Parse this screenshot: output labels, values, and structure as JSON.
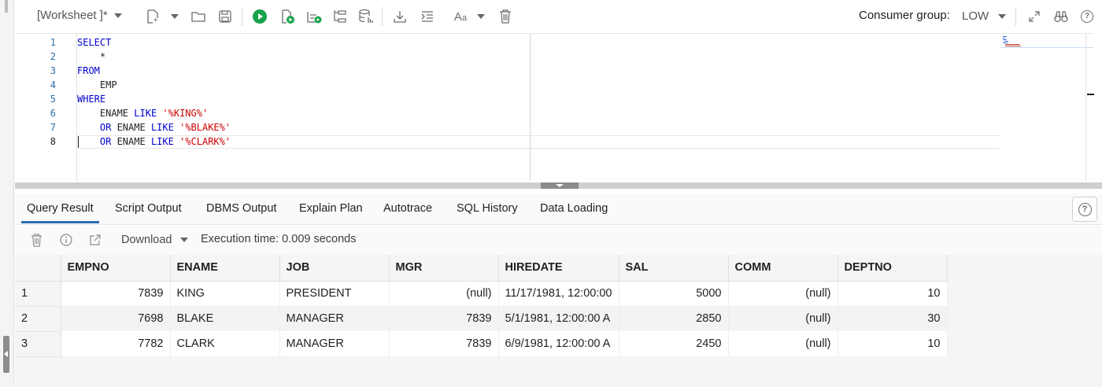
{
  "toolbar": {
    "worksheet_label": "[Worksheet ]*",
    "consumer_group_label": "Consumer group:",
    "consumer_group_value": "LOW"
  },
  "editor": {
    "line_numbers": [
      "1",
      "2",
      "3",
      "4",
      "5",
      "6",
      "7",
      "8"
    ],
    "lines": [
      {
        "kw": "SELECT"
      },
      {
        "indent": "    ",
        "id": "*"
      },
      {
        "kw": "FROM"
      },
      {
        "indent": "    ",
        "id": "EMP"
      },
      {
        "kw": "WHERE"
      },
      {
        "indent": "    ",
        "a": "ENAME ",
        "kw": "LIKE",
        "str": "'%KING%'"
      },
      {
        "indent": "    ",
        "kw1": "OR",
        "a": " ENAME ",
        "kw": "LIKE",
        "str": "'%BLAKE%'"
      },
      {
        "indent": "    ",
        "kw1": "OR",
        "a": " ENAME ",
        "kw": "LIKE",
        "str": "'%CLARK%'"
      }
    ]
  },
  "tabs": [
    {
      "label": "Query Result"
    },
    {
      "label": "Script Output"
    },
    {
      "label": "DBMS Output"
    },
    {
      "label": "Explain Plan"
    },
    {
      "label": "Autotrace"
    },
    {
      "label": "SQL History"
    },
    {
      "label": "Data Loading"
    }
  ],
  "result_toolbar": {
    "download_label": "Download",
    "execution_time": "Execution time: 0.009 seconds"
  },
  "grid": {
    "columns": [
      "EMPNO",
      "ENAME",
      "JOB",
      "MGR",
      "HIREDATE",
      "SAL",
      "COMM",
      "DEPTNO"
    ],
    "rows": [
      {
        "rownum": "1",
        "cells": [
          "7839",
          "KING",
          "PRESIDENT",
          "(null)",
          "11/17/1981, 12:00:00",
          "5000",
          "(null)",
          "10"
        ]
      },
      {
        "rownum": "2",
        "cells": [
          "7698",
          "BLAKE",
          "MANAGER",
          "7839",
          "5/1/1981, 12:00:00 A",
          "2850",
          "(null)",
          "30"
        ]
      },
      {
        "rownum": "3",
        "cells": [
          "7782",
          "CLARK",
          "MANAGER",
          "7839",
          "6/9/1981, 12:00:00 A",
          "2450",
          "(null)",
          "10"
        ]
      }
    ]
  }
}
